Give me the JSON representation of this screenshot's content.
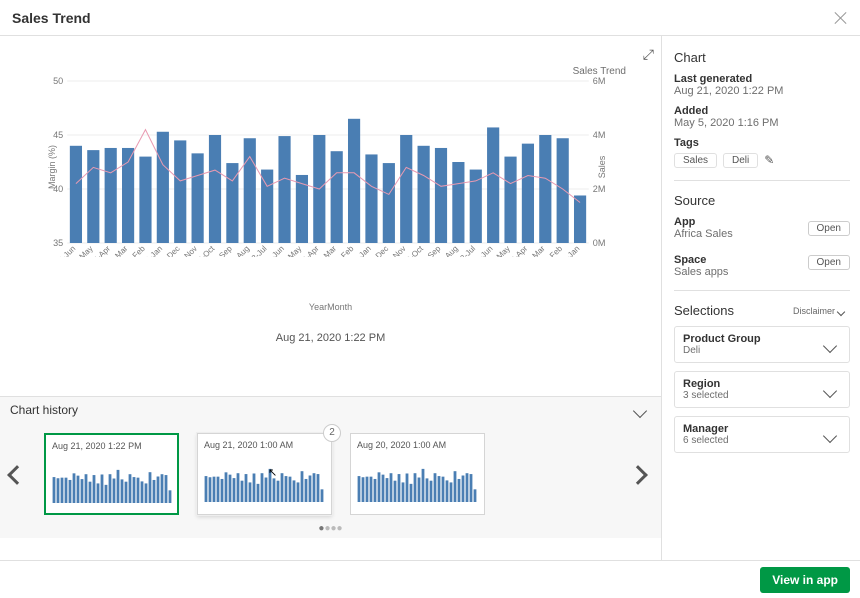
{
  "header": {
    "title": "Sales Trend"
  },
  "chart_data": {
    "type": "bar",
    "title": "Sales Trend",
    "xlabel": "YearMonth",
    "ylabel": "Margin (%)",
    "y2label": "Sales",
    "ylim": [
      35,
      50
    ],
    "y2lim": [
      0,
      6000000
    ],
    "categories": [
      "2014-Jun",
      "2014-May",
      "2014-Apr",
      "2014-Mar",
      "2014-Feb",
      "2014-Jan",
      "2013-Dec",
      "2013-Nov",
      "2013-Oct",
      "2013-Sep",
      "2013-Aug",
      "2013-Jul",
      "2013-Jun",
      "2013-May",
      "2013-Apr",
      "2013-Mar",
      "2013-Feb",
      "2013-Jan",
      "2012-Dec",
      "2012-Nov",
      "2012-Oct",
      "2012-Sep",
      "2012-Aug",
      "2012-Jul",
      "2012-Jun",
      "2012-May",
      "2012-Apr",
      "2012-Mar",
      "2012-Feb",
      "2012-Jan"
    ],
    "series": [
      {
        "name": "Margin (%)",
        "type": "bar",
        "axis": "y",
        "values": [
          44.0,
          43.6,
          43.8,
          43.8,
          43.0,
          45.3,
          44.5,
          43.3,
          45.0,
          42.4,
          44.7,
          41.8,
          44.9,
          41.3,
          45.0,
          43.5,
          46.5,
          43.2,
          42.4,
          45.0,
          44.0,
          43.8,
          42.5,
          41.8,
          45.7,
          43.0,
          44.2,
          45.0,
          44.7,
          39.4
        ]
      },
      {
        "name": "Sales",
        "type": "line",
        "axis": "y2",
        "values": [
          2200000,
          2800000,
          2600000,
          3000000,
          4200000,
          2900000,
          2300000,
          2500000,
          2700000,
          2300000,
          3200000,
          2100000,
          2400000,
          2200000,
          2000000,
          2600000,
          2600000,
          2100000,
          1800000,
          2800000,
          2500000,
          2100000,
          2200000,
          2300000,
          2600000,
          2200000,
          2500000,
          2400000,
          2000000,
          1500000
        ]
      }
    ]
  },
  "main": {
    "timestamp": "Aug 21, 2020 1:22 PM"
  },
  "history": {
    "title": "Chart history",
    "items": [
      {
        "ts": "Aug 21, 2020 1:22 PM",
        "selected": true
      },
      {
        "ts": "Aug 21, 2020 1:00 AM",
        "badge": "2",
        "hover": true
      },
      {
        "ts": "Aug 20, 2020 1:00 AM"
      }
    ],
    "dot_active": 0,
    "dot_count": 4
  },
  "side": {
    "section": "Chart",
    "last_generated_label": "Last generated",
    "last_generated": "Aug 21, 2020 1:22 PM",
    "added_label": "Added",
    "added": "May 5, 2020 1:16 PM",
    "tags_label": "Tags",
    "tags": [
      "Sales",
      "Deli"
    ],
    "source_label": "Source",
    "app_label": "App",
    "app": "Africa Sales",
    "open_label": "Open",
    "space_label": "Space",
    "space": "Sales apps",
    "selections_label": "Selections",
    "disclaimer": "Disclaimer",
    "selections": [
      {
        "name": "Product Group",
        "sub": "Deli"
      },
      {
        "name": "Region",
        "sub": "3 selected"
      },
      {
        "name": "Manager",
        "sub": "6 selected"
      }
    ]
  },
  "footer": {
    "view_in_app": "View in app"
  }
}
